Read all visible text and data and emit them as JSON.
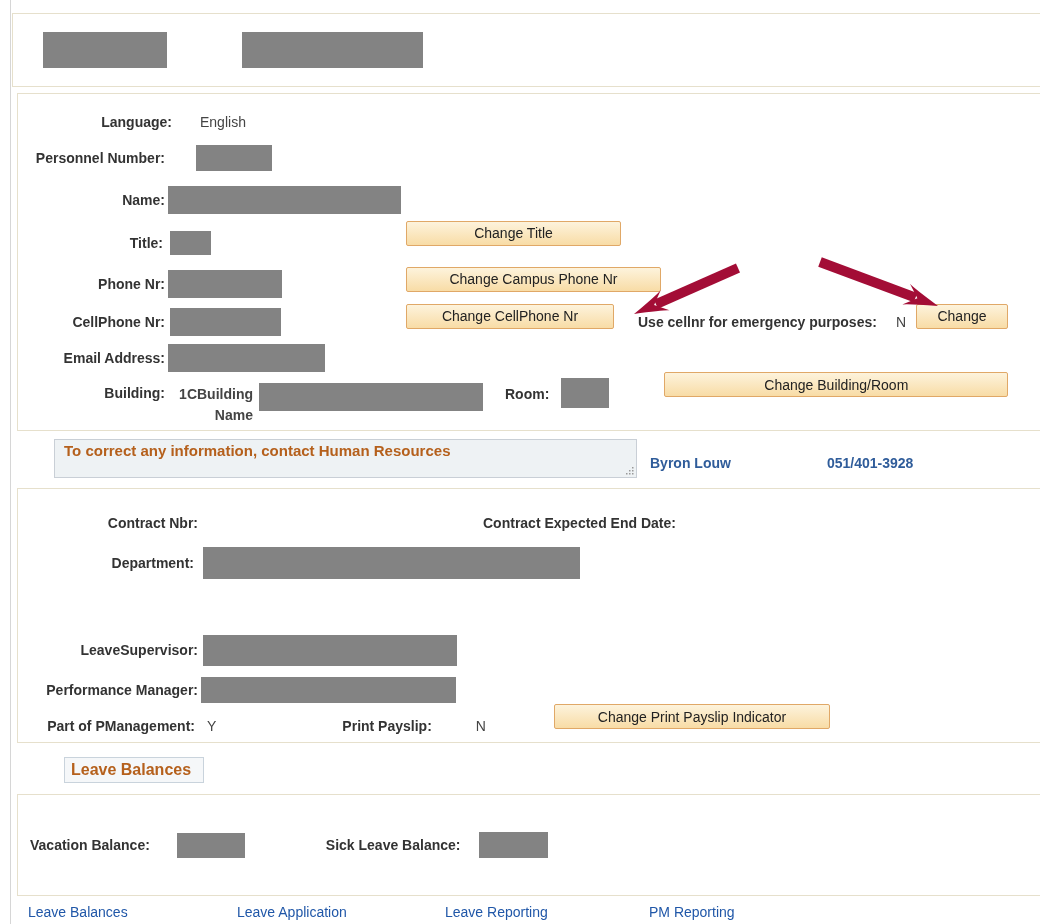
{
  "personal": {
    "language": {
      "label": "Language:",
      "value": "English"
    },
    "personnel_number": {
      "label": "Personnel Number:"
    },
    "name": {
      "label": "Name:"
    },
    "title": {
      "label": "Title:",
      "button": "Change Title"
    },
    "phone": {
      "label": "Phone Nr:",
      "button": "Change Campus Phone Nr"
    },
    "cellphone": {
      "label": "CellPhone Nr:",
      "button": "Change CellPhone Nr",
      "emergency_label": "Use cellnr for emergency purposes:",
      "emergency_value": "N",
      "emergency_button": "Change"
    },
    "email": {
      "label": "Email Address:"
    },
    "building": {
      "label": "Building:",
      "value": "1CBuilding Name",
      "room_label": "Room:",
      "button": "Change Building/Room"
    }
  },
  "hr_contact": {
    "message": "To correct any information, contact Human Resources",
    "name": "Byron Louw",
    "phone": "051/401-3928"
  },
  "employment": {
    "contract_label": "Contract Nbr:",
    "end_date_label": "Contract Expected End Date:",
    "department_label": "Department:",
    "leave_supervisor_label": "LeaveSupervisor:",
    "performance_manager_label": "Performance Manager:",
    "pm_label": "Part of PManagement:",
    "pm_value": "Y",
    "payslip_label": "Print Payslip:",
    "payslip_value": "N",
    "payslip_button": "Change Print Payslip Indicator"
  },
  "leave_tab": "Leave Balances",
  "balances": {
    "vacation_label": "Vacation Balance:",
    "sick_label": "Sick Leave Balance:"
  },
  "links": [
    "Leave Balances",
    "Leave Application",
    "Leave Reporting",
    "PM Reporting"
  ]
}
